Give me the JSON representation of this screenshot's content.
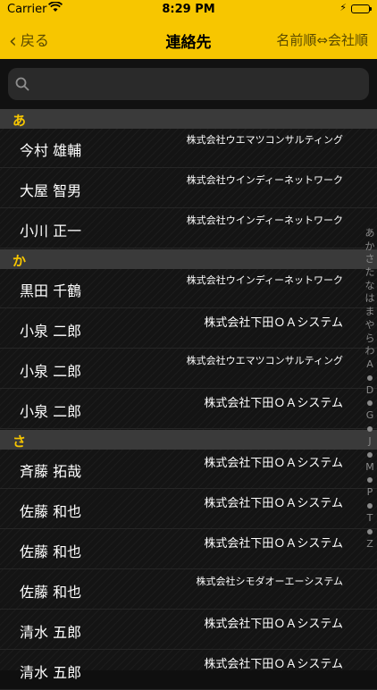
{
  "status": {
    "carrier": "Carrier",
    "time": "8:29 PM",
    "charge": "⚡"
  },
  "nav": {
    "back": "戻る",
    "title": "連絡先",
    "sort": "名前順⇔会社順"
  },
  "search": {
    "placeholder": ""
  },
  "sections": [
    {
      "letter": "あ",
      "rows": [
        {
          "name": "今村 雄輔",
          "company": "株式会社ウエマツコンサルティング",
          "size": "small"
        },
        {
          "name": "大屋 智男",
          "company": "株式会社ウインディーネットワーク",
          "size": "small"
        },
        {
          "name": "小川 正一",
          "company": "株式会社ウインディーネットワーク",
          "size": "small"
        }
      ]
    },
    {
      "letter": "か",
      "rows": [
        {
          "name": "黒田 千鶴",
          "company": "株式会社ウインディーネットワーク",
          "size": "small"
        },
        {
          "name": "小泉 二郎",
          "company": "株式会社下田ＯＡシステム",
          "size": "big"
        },
        {
          "name": "小泉 二郎",
          "company": "株式会社ウエマツコンサルティング",
          "size": "small"
        },
        {
          "name": "小泉 二郎",
          "company": "株式会社下田ＯＡシステム",
          "size": "big"
        }
      ]
    },
    {
      "letter": "さ",
      "rows": [
        {
          "name": "斉藤 拓哉",
          "company": "株式会社下田ＯＡシステム",
          "size": "big"
        },
        {
          "name": "佐藤 和也",
          "company": "株式会社下田ＯＡシステム",
          "size": "big"
        },
        {
          "name": "佐藤 和也",
          "company": "株式会社下田ＯＡシステム",
          "size": "big"
        },
        {
          "name": "佐藤 和也",
          "company": "株式会社シモダオーエーシステム",
          "size": "small"
        },
        {
          "name": "清水 五郎",
          "company": "株式会社下田ＯＡシステム",
          "size": "big"
        },
        {
          "name": "清水 五郎",
          "company": "株式会社下田ＯＡシステム",
          "size": "big"
        }
      ]
    }
  ],
  "index": [
    "あ",
    "か",
    "さ",
    "た",
    "な",
    "は",
    "ま",
    "や",
    "ら",
    "わ",
    "A",
    "•",
    "D",
    "•",
    "G",
    "•",
    "J",
    "•",
    "M",
    "•",
    "P",
    "•",
    "T",
    "•",
    "Z"
  ]
}
